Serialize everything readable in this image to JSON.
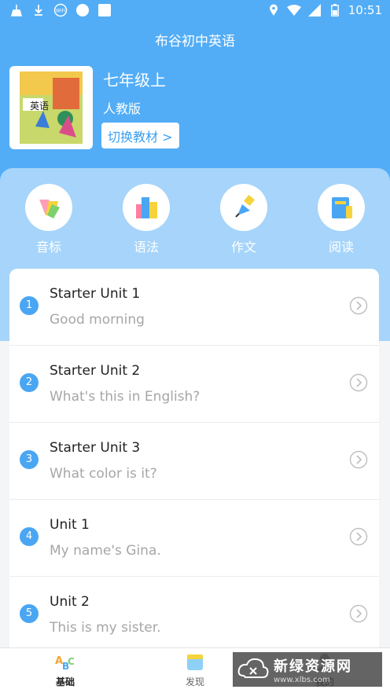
{
  "status_bar": {
    "time": "10:51",
    "left_icons": [
      "broom-icon",
      "download-icon",
      "wifi-badge-icon",
      "circle-icon",
      "square-icon"
    ],
    "right_icons": [
      "location-icon",
      "wifi-icon",
      "signal-icon",
      "battery-icon"
    ]
  },
  "header": {
    "title": "布谷初中英语"
  },
  "book": {
    "cover_text": "英语",
    "title": "七年级上",
    "edition": "人教版",
    "switch_label": "切换教材 >"
  },
  "categories": [
    {
      "label": "音标",
      "icon": "pencil-icon"
    },
    {
      "label": "语法",
      "icon": "books-icon"
    },
    {
      "label": "作文",
      "icon": "pen-nib-icon"
    },
    {
      "label": "阅读",
      "icon": "book-icon"
    }
  ],
  "units": [
    {
      "num": "1",
      "title": "Starter Unit 1",
      "subtitle": "Good morning"
    },
    {
      "num": "2",
      "title": "Starter Unit 2",
      "subtitle": "What's this in English?"
    },
    {
      "num": "3",
      "title": "Starter Unit 3",
      "subtitle": "What color is it?"
    },
    {
      "num": "4",
      "title": "Unit 1",
      "subtitle": "My name's Gina."
    },
    {
      "num": "5",
      "title": "Unit 2",
      "subtitle": "This is my sister."
    }
  ],
  "bottom_nav": [
    {
      "label": "基础",
      "icon": "abc-icon",
      "active": true
    },
    {
      "label": "发现",
      "icon": "discover-icon",
      "active": false
    },
    {
      "label": "我的",
      "icon": "profile-icon",
      "active": false
    }
  ],
  "watermark": {
    "title": "新绿资源网",
    "url": "www.xlbs.com"
  },
  "colors": {
    "primary": "#52adf6",
    "panel": "#a6d4fa",
    "badge": "#4aa6f3"
  }
}
